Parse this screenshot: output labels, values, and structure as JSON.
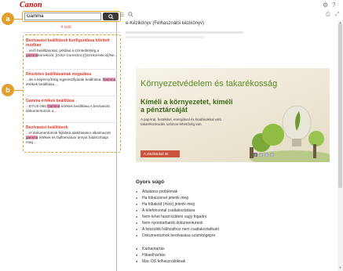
{
  "header": {
    "logo": "Canon",
    "settings_icon": "gear-icon",
    "help_icon": "question-icon"
  },
  "sidebar": {
    "search_value": "Gamma",
    "search_icon": "search-icon",
    "total": "4 talál",
    "results": [
      {
        "title": "Beolvasási beállítások konfigurálása bővített módban",
        "snippet_pre": "...verő beállításokat, például a színtelítet",
        "snippet_mid": "ség a ",
        "highlight": "gamma",
        "snippet_post": "korrekciót, [Color Correction] [Színkorrekció]/Ne..."
      },
      {
        "title": "Részletes beállításainak megadása",
        "snippet_pre": "...de a képernyőnkig egyenszílyánák beállítása: ",
        "snippet_mid": "",
        "highlight": "Gamma",
        "snippet_post": " értékek beállítása ..."
      },
      {
        "title": "Gamma értékek beállítása",
        "snippet_pre": "...DYUS-065 ",
        "snippet_mid": "",
        "highlight": "Gamma",
        "snippet_post": " értékek beállítása A beolvasott dokumentumok a..."
      },
      {
        "title": "Beolvasási beállítások",
        "snippet_pre": "...nt dokumentumok fájlokká alakításakor alkalmazott ",
        "snippet_mid": "",
        "highlight": "gamma",
        "snippet_post": " értékek és fájlformátum árnyat határozhatja meg..."
      }
    ],
    "callouts": [
      "a",
      "b"
    ]
  },
  "toolbar": {
    "menu_icon": "hamburger-menu-icon",
    "search_icon": "search-icon",
    "print_icon": "print-icon",
    "expand_icon": "expand-icon"
  },
  "main": {
    "breadcrumb": "e-Kézikönyv (Felhasználói kézikönyv)",
    "banner": {
      "title": "Környezetvédelem és takarékosság",
      "subtitle": "Kíméli a környezetet, kíméli a pénztárcáját",
      "description": "A papírral, festékkel, energiával és kiadásokkal való takarékoskodás számos lehetőség van.",
      "button": "A részletekel itt!",
      "pages": [
        "1",
        "2",
        "3",
        "4"
      ],
      "accent": "#5a8a25"
    },
    "quick_title": "Gyors súgó",
    "quick_items": [
      "Általános problémák",
      "Ha hibaüzenet jelenik meg",
      "Ha hibakód (#xxx) jelenik meg",
      "A telefonvonal csatlakoztatása",
      "Nem lehet faxot küldeni vagy fogadni",
      "Nem nyomtathatók dokumentumok",
      "A készülék hálózathoz nem csatlakoztatható",
      "Dokumentumok beolvasása számítógépre"
    ],
    "quick_items2": [
      "Karbantartás",
      "Hibaelhárítás",
      "Mac OS felhasználóknak"
    ]
  },
  "colors": {
    "callout": "#e0a030",
    "result_title": "#e04030",
    "highlight": "#f5a0c0",
    "brand": "#cc0000"
  }
}
